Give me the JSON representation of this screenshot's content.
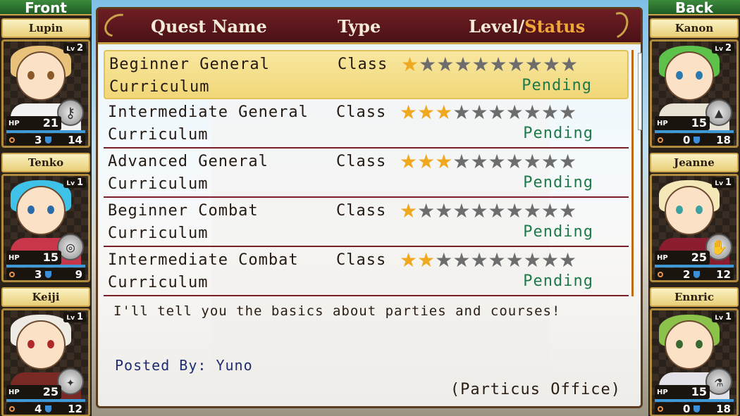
{
  "front_label": "Front",
  "back_label": "Back",
  "front": [
    {
      "name": "Lupin",
      "lv": "2",
      "hp": "21",
      "a": "3",
      "b": "14",
      "hair": "#e8c27a",
      "eyes": "#8a5a2a",
      "body": "#f2f2f2",
      "eq": "⚷"
    },
    {
      "name": "Tenko",
      "lv": "1",
      "hp": "15",
      "a": "3",
      "b": "9",
      "hair": "#3fc2e8",
      "eyes": "#2a6aa8",
      "body": "#c8364a",
      "eq": "◎"
    },
    {
      "name": "Keiji",
      "lv": "1",
      "hp": "25",
      "a": "4",
      "b": "12",
      "hair": "#eeeae4",
      "eyes": "#b02a2a",
      "body": "#7a2a24",
      "eq": "✦"
    }
  ],
  "back": [
    {
      "name": "Kanon",
      "lv": "2",
      "hp": "15",
      "a": "0",
      "b": "18",
      "hair": "#5cc24a",
      "eyes": "#2a7ab0",
      "body": "#e8e2d4",
      "eq": "▲"
    },
    {
      "name": "Jeanne",
      "lv": "1",
      "hp": "25",
      "a": "2",
      "b": "12",
      "hair": "#f4e7b8",
      "eyes": "#3aa0a0",
      "body": "#8a1e30",
      "eq": "✋"
    },
    {
      "name": "Ennric",
      "lv": "1",
      "hp": "15",
      "a": "0",
      "b": "18",
      "hair": "#8ac24a",
      "eyes": "#3a6a30",
      "body": "#e2e2e8",
      "eq": "⚗"
    }
  ],
  "lv_label": "Lv",
  "hp_label": "HP",
  "header": {
    "name": "Quest Name",
    "type": "Type",
    "level": "Level/",
    "status": "Status"
  },
  "quests": [
    {
      "line1": "Beginner General",
      "line2": "Curriculum",
      "type": "Class",
      "stars": 1,
      "status": "Pending",
      "selected": true
    },
    {
      "line1": "Intermediate General",
      "line2": "Curriculum",
      "type": "Class",
      "stars": 3,
      "status": "Pending",
      "selected": false
    },
    {
      "line1": "Advanced General",
      "line2": "Curriculum",
      "type": "Class",
      "stars": 3,
      "status": "Pending",
      "selected": false
    },
    {
      "line1": "Beginner Combat",
      "line2": "Curriculum",
      "type": "Class",
      "stars": 1,
      "status": "Pending",
      "selected": false
    },
    {
      "line1": "Intermediate Combat",
      "line2": "Curriculum",
      "type": "Class",
      "stars": 2,
      "status": "Pending",
      "selected": false
    }
  ],
  "max_stars": 10,
  "description": "I'll tell you the basics about parties and courses!",
  "posted_by": "Posted By: Yuno",
  "office": "(Particus Office)"
}
